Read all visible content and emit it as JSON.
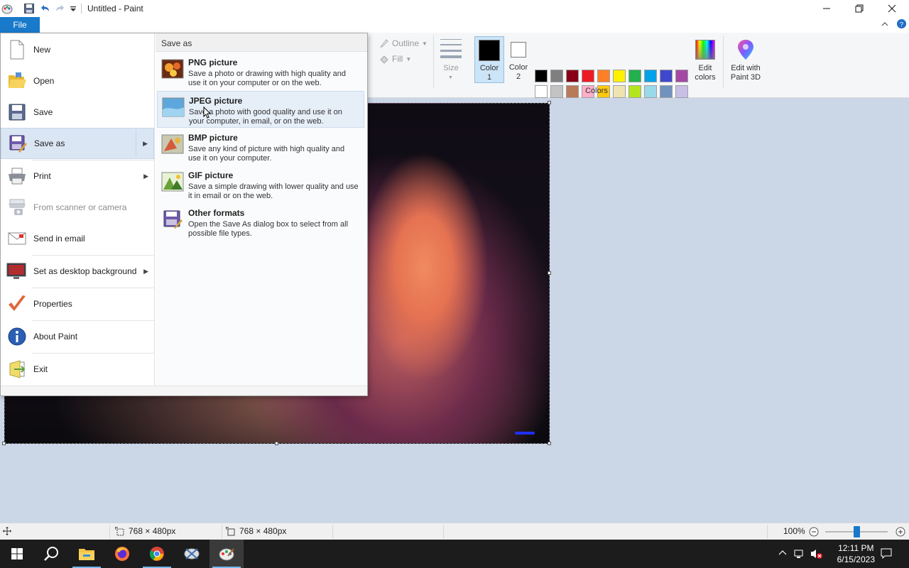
{
  "window": {
    "title": "Untitled - Paint"
  },
  "ribbon": {
    "file_tab": "File",
    "outline_label": "Outline",
    "fill_label": "Fill",
    "size_label": "Size",
    "color1_label": "Color\n1",
    "color1_line1": "Color",
    "color1_line2": "1",
    "color2_line1": "Color",
    "color2_line2": "2",
    "edit_colors_line1": "Edit",
    "edit_colors_line2": "colors",
    "paint3d_line1": "Edit with",
    "paint3d_line2": "Paint 3D",
    "colors_group_label": "Colors",
    "color1_value": "#000000",
    "color2_value": "#ffffff",
    "palette_row1": [
      "#000000",
      "#7f7f7f",
      "#880015",
      "#ed1c24",
      "#ff7f27",
      "#fff200",
      "#22b14c",
      "#00a2e8",
      "#3f48cc",
      "#a349a4"
    ],
    "palette_row2": [
      "#ffffff",
      "#c3c3c3",
      "#b97a57",
      "#ffaec9",
      "#ffc90e",
      "#efe4b0",
      "#b5e61d",
      "#99d9ea",
      "#7092be",
      "#c8bfe7"
    ]
  },
  "file_menu": {
    "items": [
      {
        "label": "New"
      },
      {
        "label": "Open"
      },
      {
        "label": "Save"
      },
      {
        "label": "Save as"
      },
      {
        "label": "Print"
      },
      {
        "label": "From scanner or camera"
      },
      {
        "label": "Send in email"
      },
      {
        "label": "Set as desktop background"
      },
      {
        "label": "Properties"
      },
      {
        "label": "About Paint"
      },
      {
        "label": "Exit"
      }
    ],
    "save_as": {
      "heading": "Save as",
      "formats": [
        {
          "title": "PNG picture",
          "desc": "Save a photo or drawing with high quality and use it on your computer or on the web."
        },
        {
          "title": "JPEG picture",
          "desc": "Save a photo with good quality and use it on your computer, in email, or on the web."
        },
        {
          "title": "BMP picture",
          "desc": "Save any kind of picture with high quality and use it on your computer."
        },
        {
          "title": "GIF picture",
          "desc": "Save a simple drawing with lower quality and use it in email or on the web."
        },
        {
          "title": "Other formats",
          "desc": "Open the Save As dialog box to select from all possible file types."
        }
      ]
    }
  },
  "statusbar": {
    "selection_size": "768 × 480px",
    "image_size": "768 × 480px",
    "zoom": "100%",
    "zoom_fraction": 0.5
  },
  "taskbar": {
    "time": "12:11 PM",
    "date": "6/15/2023"
  }
}
